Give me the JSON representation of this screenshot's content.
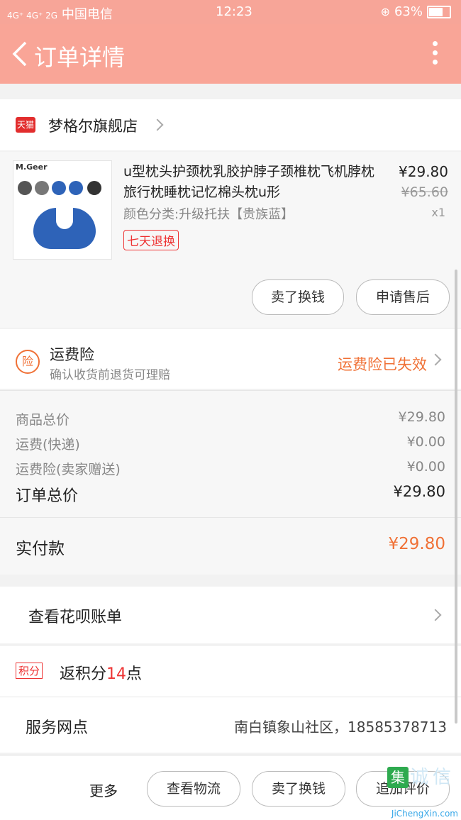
{
  "status_bar": {
    "network": "4G⁺ 4G⁺ 2G",
    "carrier": "中国电信",
    "time": "12:23",
    "battery": "63%",
    "battery_level": 0.63
  },
  "header": {
    "title": "订单详情"
  },
  "shop": {
    "badge": "天猫",
    "name": "梦格尔旗舰店"
  },
  "product": {
    "image_brand": "M.Geer",
    "title": "u型枕头护颈枕乳胶护脖子颈椎枕飞机脖枕旅行枕睡枕记忆棉头枕u形",
    "spec": "颜色分类:升级托扶【贵族蓝】",
    "tag": "七天退换",
    "price": "¥29.80",
    "original_price": "¥65.60",
    "quantity": "x1",
    "buttons": [
      "卖了换钱",
      "申请售后"
    ]
  },
  "insurance": {
    "icon": "险",
    "title": "运费险",
    "subtitle": "确认收货前退货可理赔",
    "status": "运费险已失效"
  },
  "summary": {
    "items": [
      {
        "label": "商品总价",
        "value": "¥29.80"
      },
      {
        "label": "运费(快递)",
        "value": "¥0.00"
      },
      {
        "label": "运费险(卖家赠送)",
        "value": "¥0.00"
      }
    ],
    "total_label": "订单总价",
    "total_value": "¥29.80",
    "paid_label": "实付款",
    "paid_value": "¥29.80"
  },
  "huabei": {
    "label": "查看花呗账单"
  },
  "points": {
    "badge": "积分",
    "text_prefix": "返积分",
    "points": "14",
    "text_suffix": "点"
  },
  "service": {
    "label": "服务网点",
    "value": "南白镇象山社区，18585378713"
  },
  "bottom": {
    "more": "更多",
    "buttons": [
      "查看物流",
      "卖了换钱",
      "追加评价"
    ]
  },
  "watermark": {
    "site": "JiChengXin.com",
    "chars": [
      "集",
      "诚",
      "信"
    ]
  },
  "colors": {
    "header": "#f9a597",
    "accent": "#f07136",
    "tmall": "#e22d2d"
  }
}
